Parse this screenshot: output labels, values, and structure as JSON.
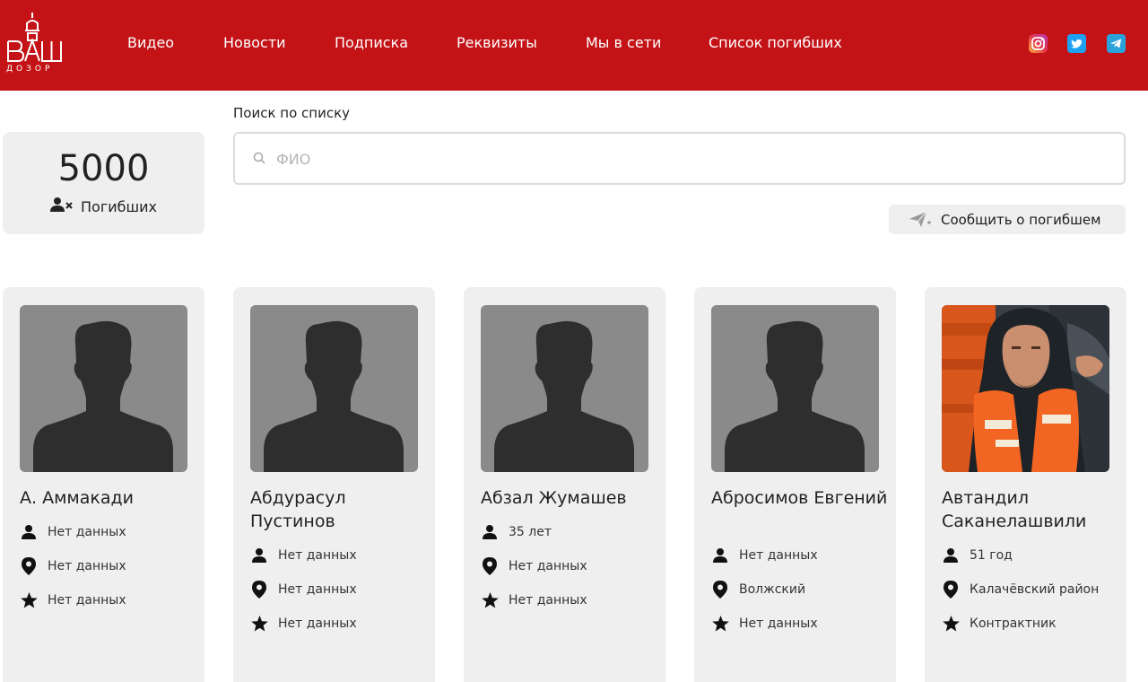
{
  "brand": {
    "logo_text": "ВАШ",
    "logo_subtitle": "ДОЗОР",
    "header_color": "#c41317"
  },
  "nav": {
    "items": [
      {
        "label": "Видео"
      },
      {
        "label": "Новости"
      },
      {
        "label": "Подписка"
      },
      {
        "label": "Реквизиты"
      },
      {
        "label": "Мы в сети"
      },
      {
        "label": "Список погибших"
      }
    ]
  },
  "social": {
    "items": [
      {
        "icon": "instagram-icon"
      },
      {
        "icon": "twitter-icon"
      },
      {
        "icon": "telegram-icon"
      }
    ]
  },
  "counter": {
    "number": "5000",
    "label": "Погибших",
    "icon": "user-remove-icon"
  },
  "search": {
    "label": "Поиск по списку",
    "placeholder": "ФИО",
    "value": "",
    "icon": "search-icon"
  },
  "report_button": {
    "label": "Сообщить о погибшем",
    "icon": "send-plane-icon"
  },
  "cards": [
    {
      "name": "А. Аммакади",
      "age": "Нет данных",
      "location": "Нет данных",
      "status": "Нет данных",
      "photo": "placeholder-silhouette"
    },
    {
      "name": "Абдурасул Пустинов",
      "age": "Нет данных",
      "location": "Нет данных",
      "status": "Нет данных",
      "photo": "placeholder-silhouette"
    },
    {
      "name": "Абзал Жумашев",
      "age": "35 лет",
      "location": "Нет данных",
      "status": "Нет данных",
      "photo": "placeholder-silhouette"
    },
    {
      "name": "Абросимов Евгений",
      "age": "Нет данных",
      "location": "Волжский",
      "status": "Нет данных",
      "photo": "placeholder-silhouette"
    },
    {
      "name": "Автандил Саканелашвили",
      "age": "51 год",
      "location": "Калачёвский район",
      "status": "Контрактник",
      "photo": "man-in-orange-life-vest"
    }
  ]
}
